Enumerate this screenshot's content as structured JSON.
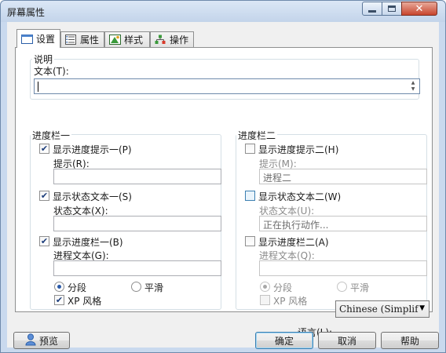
{
  "window": {
    "title": "屏幕属性"
  },
  "tabs": [
    {
      "label": "设置",
      "icon": "settings-window-icon",
      "active": true
    },
    {
      "label": "属性",
      "icon": "properties-list-icon",
      "active": false
    },
    {
      "label": "样式",
      "icon": "style-palette-icon",
      "active": false
    },
    {
      "label": "操作",
      "icon": "actions-tree-icon",
      "active": false
    }
  ],
  "description": {
    "group_label": "说明",
    "text_label": "文本(T):",
    "text_value": ""
  },
  "progress_one": {
    "group_label": "进度栏一",
    "show_tip": {
      "label": "显示进度提示一(P)",
      "checked": true
    },
    "tip_label": "提示(R):",
    "tip_value": "",
    "show_status": {
      "label": "显示状态文本一(S)",
      "checked": true
    },
    "status_label": "状态文本(X):",
    "status_value": "",
    "show_bar": {
      "label": "显示进度栏一(B)",
      "checked": true
    },
    "progress_label": "进程文本(G):",
    "progress_value": "",
    "radio_segment": {
      "label": "分段",
      "selected": true
    },
    "radio_smooth": {
      "label": "平滑",
      "selected": false
    },
    "xp_style": {
      "label": "XP 风格",
      "checked": true
    }
  },
  "progress_two": {
    "group_label": "进度栏二",
    "show_tip": {
      "label": "显示进度提示二(H)",
      "checked": false
    },
    "tip_label": "提示(M):",
    "tip_value": "进程二",
    "show_status": {
      "label": "显示状态文本二(W)",
      "checked": false
    },
    "status_label": "状态文本(U):",
    "status_value": "正在执行动作...",
    "show_bar": {
      "label": "显示进度栏二(A)",
      "checked": false
    },
    "progress_label": "进程文本(Q):",
    "progress_value": "",
    "radio_segment": {
      "label": "分段",
      "selected": true
    },
    "radio_smooth": {
      "label": "平滑",
      "selected": false
    },
    "xp_style": {
      "label": "XP 风格",
      "checked": false
    }
  },
  "language": {
    "label": "语言(L):",
    "value": "Chinese (Simplif"
  },
  "buttons": {
    "preview": "预览",
    "ok": "确定",
    "cancel": "取消",
    "help": "帮助"
  },
  "colors": {
    "frame": "#c9d9ee",
    "client": "#f0f0f0",
    "close_button": "#c8452d"
  }
}
